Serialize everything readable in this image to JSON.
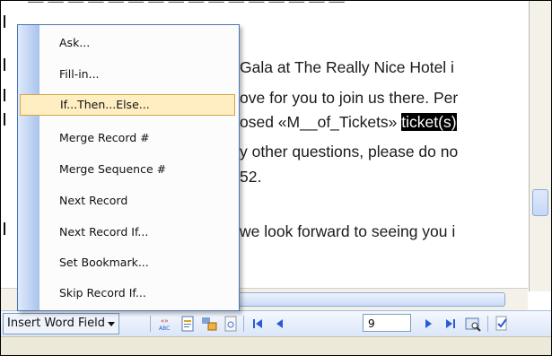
{
  "document": {
    "lines": [
      {
        "text": "Gala at The Really Nice Hotel i"
      },
      {
        "text": "ove for you to join us there. Per"
      },
      {
        "text": "osed «M__of_Tickets» ",
        "selected": "ticket(s)"
      },
      {
        "text": "y other questions, please do no"
      },
      {
        "text": "52."
      },
      {
        "text": "we look forward to seeing you i"
      }
    ]
  },
  "menu": {
    "items": [
      {
        "label": "Ask..."
      },
      {
        "label": "Fill-in..."
      },
      {
        "label": "If...Then...Else...",
        "highlighted": true
      },
      {
        "label": "Merge Record #"
      },
      {
        "label": "Merge Sequence #"
      },
      {
        "label": "Next Record"
      },
      {
        "label": "Next Record If..."
      },
      {
        "label": "Set Bookmark..."
      },
      {
        "label": "Skip Record If..."
      }
    ]
  },
  "toolbar": {
    "insert_word_field_label": "Insert Word Field",
    "buttons": [
      "merge-field-codes-icon",
      "show-fields-icon",
      "field-shading-icon",
      "recalc-icon",
      "first-record-icon",
      "previous-record-icon",
      "next-record-icon",
      "last-record-icon",
      "find-entry-icon",
      "check-errors-icon"
    ],
    "record_number": "9"
  },
  "colors": {
    "menu_border": "#4d75b3",
    "menu_highlight": "#ffeec2",
    "menu_highlight_border": "#d3a545",
    "toolbar_bg": "#dbe6f8",
    "nav_arrow": "#2a5ad7",
    "selection_bg": "#000000"
  }
}
